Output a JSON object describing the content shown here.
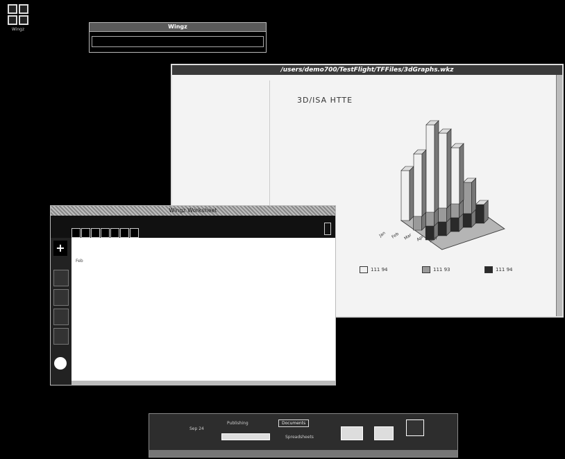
{
  "desktop": {
    "icon_label": "Wingz"
  },
  "wingz_window": {
    "title": "Wingz"
  },
  "chart_window": {
    "title": "/users/demo700/TestFlight/TFFiles/3dGraphs.wkz",
    "chart_caption": "3D/ISA HTTE"
  },
  "chart_data": {
    "type": "bar",
    "categories": [
      "Jan",
      "Feb",
      "Mar",
      "Apr",
      "May"
    ],
    "series": [
      {
        "name": "",
        "values": [
          8,
          10,
          14,
          12,
          9
        ]
      },
      {
        "name": "",
        "values": [
          6,
          9,
          11,
          7,
          5
        ]
      },
      {
        "name": "",
        "values": [
          4,
          5,
          6,
          5,
          3
        ]
      }
    ],
    "legend": [
      "111 94",
      "111 93",
      "111 94"
    ],
    "colors": [
      "#f0f0f0",
      "#9a9a9a",
      "#2a2a2a"
    ]
  },
  "sheet_window": {
    "title": "Wingz Worksheet",
    "rows": [
      [
        "",
        "",
        "",
        "",
        ""
      ],
      [
        "Feb",
        "",
        "",
        "",
        ""
      ],
      [
        "",
        "",
        "",
        "",
        ""
      ],
      [
        "",
        "",
        "",
        "",
        ""
      ],
      [
        "",
        "",
        "",
        "",
        ""
      ],
      [
        "",
        "",
        "",
        "",
        ""
      ],
      [
        "",
        "",
        "",
        "",
        ""
      ],
      [
        "",
        "",
        "",
        "",
        ""
      ],
      [
        "",
        "",
        "",
        "",
        ""
      ],
      [
        "",
        "",
        "",
        "",
        ""
      ],
      [
        "",
        "",
        "",
        "",
        ""
      ],
      [
        "",
        "",
        "",
        "",
        ""
      ],
      [
        "",
        "",
        "",
        "",
        ""
      ],
      [
        "",
        "",
        "",
        "",
        ""
      ],
      [
        "",
        "",
        "",
        "",
        ""
      ]
    ]
  },
  "dock": {
    "date": "Sep 24",
    "publishing": "Publishing",
    "documents": "Documents",
    "spreadsheets": "Spreadsheets"
  },
  "colors": {
    "background": "#000000",
    "window_bg": "#f3f3f3"
  }
}
